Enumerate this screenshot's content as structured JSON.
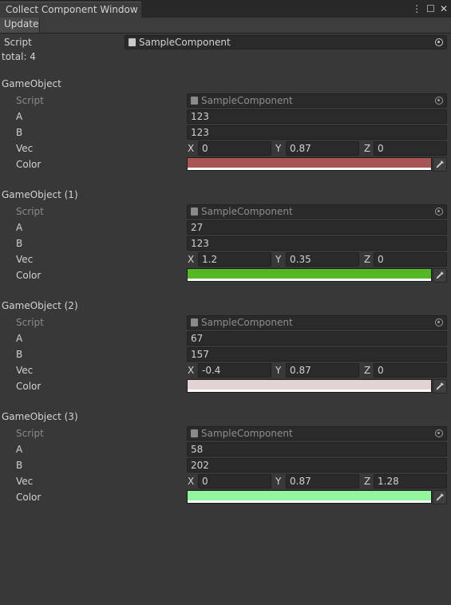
{
  "window": {
    "title": "Collect Component Window",
    "controls": {
      "menu_glyph": "⋮",
      "maximize_glyph": "☐",
      "close_glyph": "✕"
    }
  },
  "toolbar": {
    "update_label": "Update"
  },
  "header": {
    "script_label": "Script",
    "script_value": "SampleComponent",
    "total_text": "total: 4"
  },
  "labels": {
    "script": "Script",
    "a": "A",
    "b": "B",
    "vec": "Vec",
    "color": "Color",
    "x": "X",
    "y": "Y",
    "z": "Z"
  },
  "objects": [
    {
      "name": "GameObject",
      "script": "SampleComponent",
      "a": "123",
      "b": "123",
      "vec": {
        "x": "0",
        "y": "0.87",
        "z": "0"
      },
      "color": "#a85555"
    },
    {
      "name": "GameObject (1)",
      "script": "SampleComponent",
      "a": "27",
      "b": "123",
      "vec": {
        "x": "1.2",
        "y": "0.35",
        "z": "0"
      },
      "color": "#56b725"
    },
    {
      "name": "GameObject (2)",
      "script": "SampleComponent",
      "a": "67",
      "b": "157",
      "vec": {
        "x": "-0.4",
        "y": "0.87",
        "z": "0"
      },
      "color": "#e3d3d3"
    },
    {
      "name": "GameObject (3)",
      "script": "SampleComponent",
      "a": "58",
      "b": "202",
      "vec": {
        "x": "0",
        "y": "0.87",
        "z": "1.28"
      },
      "color": "#93f59d"
    }
  ]
}
